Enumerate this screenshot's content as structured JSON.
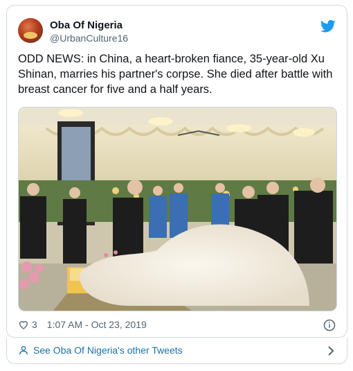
{
  "tweet": {
    "display_name": "Oba Of Nigeria",
    "handle": "@UrbanCulture16",
    "text": "ODD NEWS: in China, a heart-broken fiance, 35-year-old Xu Shinan, marries his partner's corpse. She died after battle with breast cancer for five and a half years.",
    "likes": "3",
    "timestamp": "1:07 AM - Oct 23, 2019"
  },
  "footer": {
    "link_label": "See Oba Of Nigeria's other Tweets"
  },
  "icons": {
    "brand": "twitter-bird-icon",
    "like": "heart-icon",
    "info": "info-icon",
    "profile": "person-icon",
    "more": "chevron-right-icon"
  },
  "colors": {
    "twitter_blue": "#1d9bf0",
    "text": "#0f1419",
    "secondary": "#536471",
    "link": "#1d6fa5",
    "border": "#cfd9de"
  }
}
